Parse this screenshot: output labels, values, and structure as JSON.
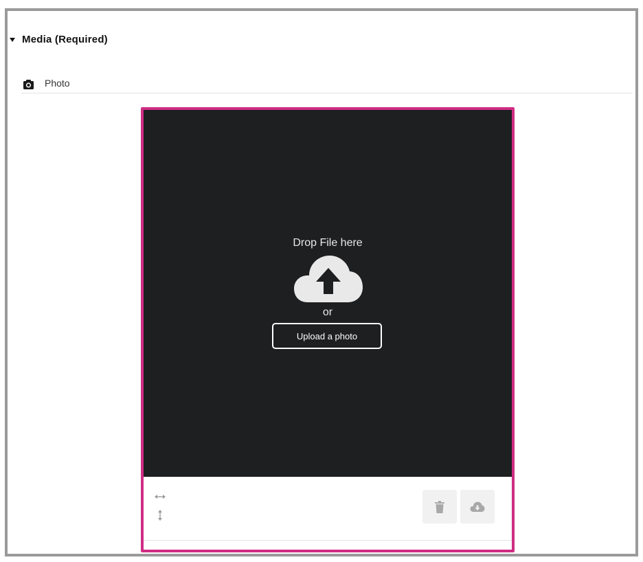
{
  "section": {
    "title": "Media (Required)",
    "caret_icon": "caret-down-icon"
  },
  "field": {
    "icon": "camera-icon",
    "label": "Photo"
  },
  "uploader": {
    "drop_text": "Drop File here",
    "cloud_icon": "cloud-upload-icon",
    "or_text": "or",
    "upload_button_label": "Upload a photo",
    "accent_color": "#cf2d85",
    "dropzone_color": "#1e1f21"
  },
  "toolbar": {
    "resize_width_icon": "arrows-horizontal-icon",
    "resize_height_icon": "arrows-vertical-icon",
    "delete_icon": "trash-icon",
    "download_icon": "cloud-download-icon"
  }
}
